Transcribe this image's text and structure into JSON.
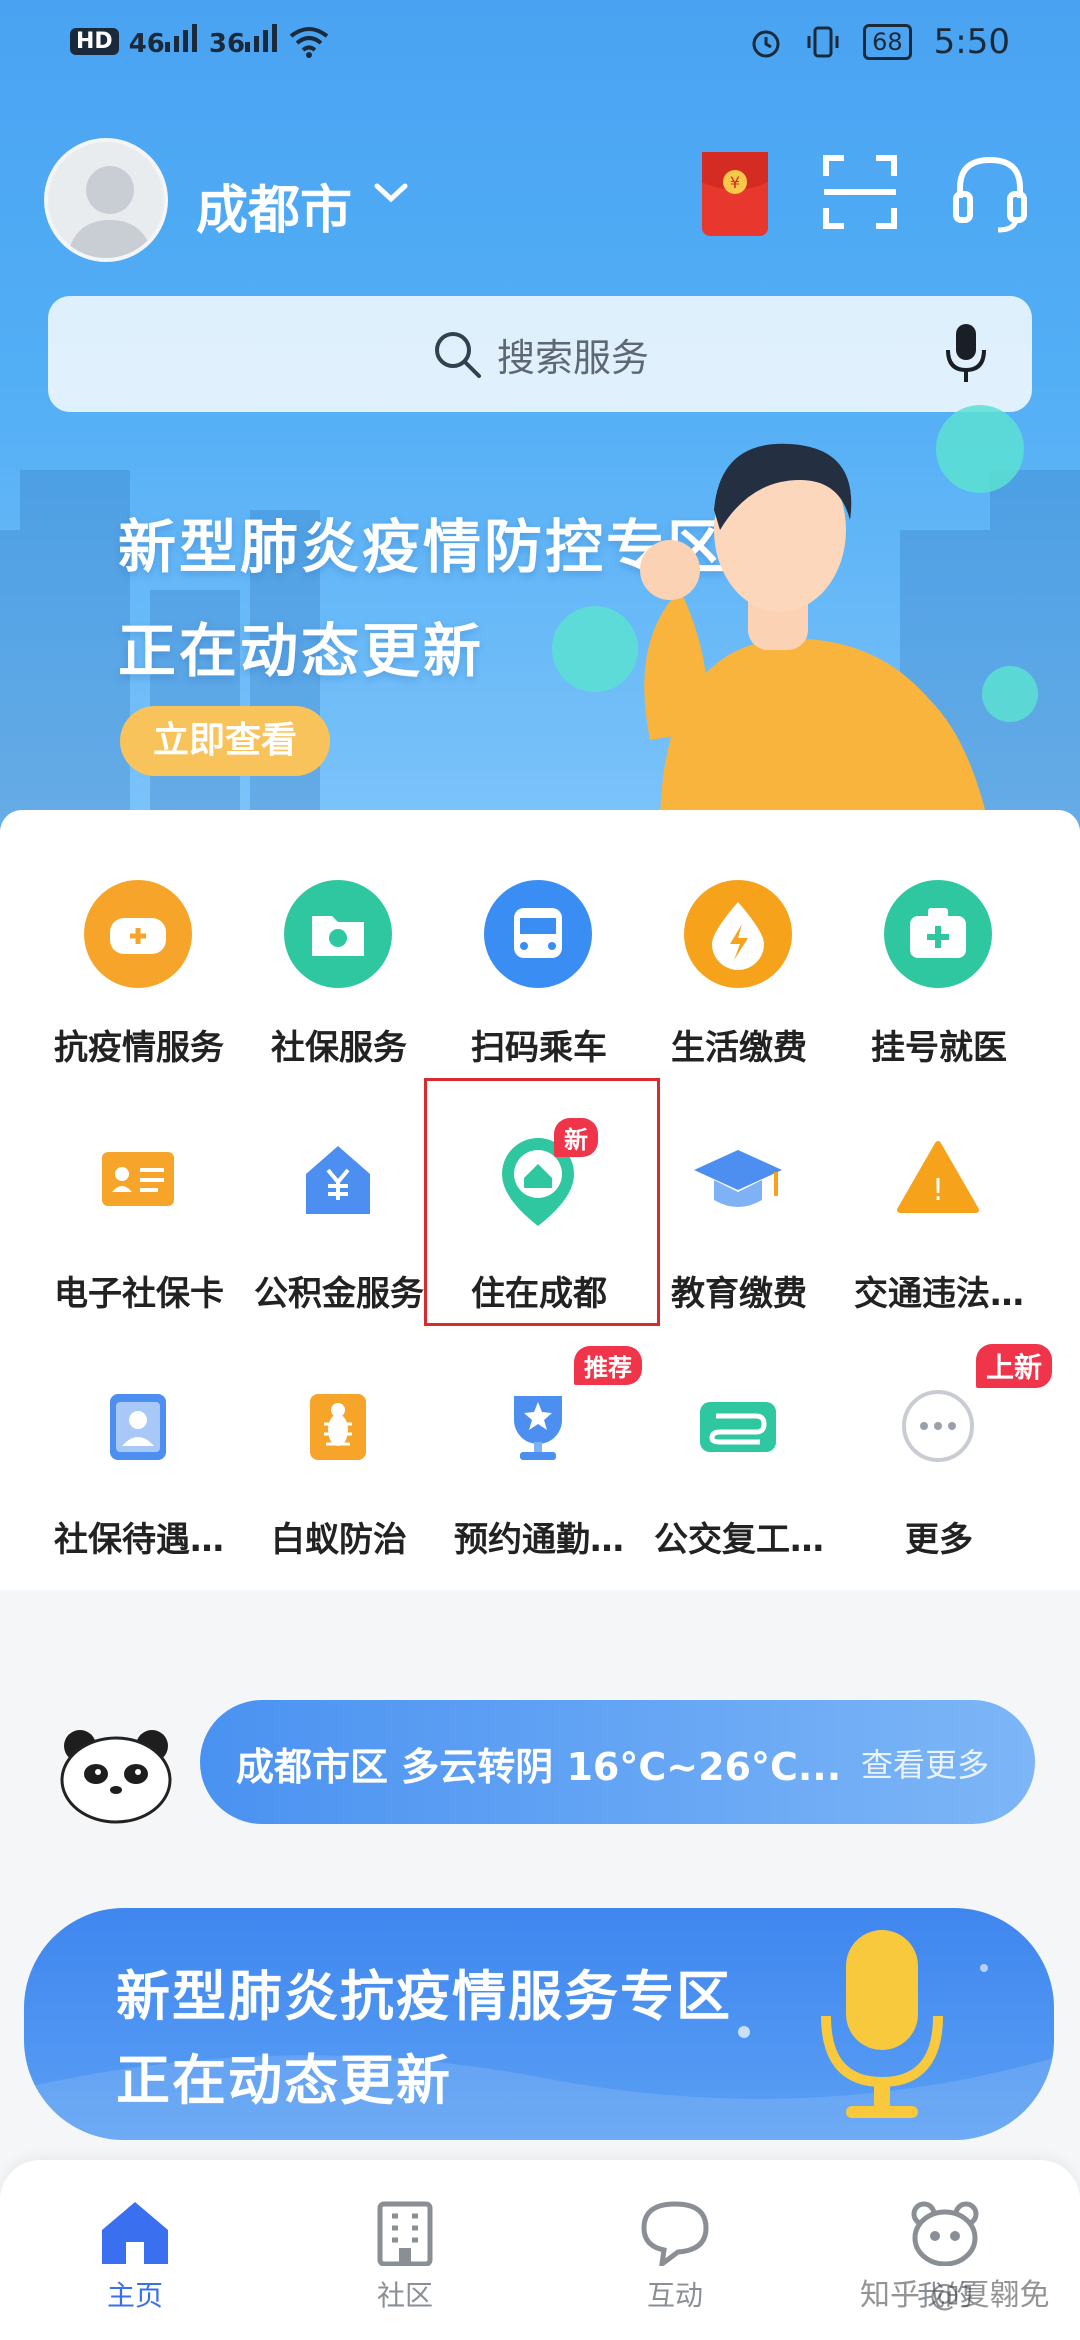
{
  "status_bar": {
    "network_left": "HD",
    "net1": "46",
    "net2": "36",
    "battery": "68",
    "time": "5:50"
  },
  "header": {
    "city": "成都市",
    "search_placeholder": "搜索服务"
  },
  "banner": {
    "line1": "新型肺炎疫情防控专区",
    "line2": "正在动态更新",
    "button": "立即查看"
  },
  "services": [
    {
      "label": "抗疫情服务",
      "icon": "mask-icon",
      "color": "#f6a52a"
    },
    {
      "label": "社保服务",
      "icon": "social-security-folder-icon",
      "color": "#2fc7a0"
    },
    {
      "label": "扫码乘车",
      "icon": "bus-icon",
      "color": "#3a8df2"
    },
    {
      "label": "生活缴费",
      "icon": "lightning-drop-icon",
      "color": "#f7a21b"
    },
    {
      "label": "挂号就医",
      "icon": "medical-kit-icon",
      "color": "#2fc7a0"
    },
    {
      "label": "电子社保卡",
      "icon": "id-card-icon",
      "color": "#f6a52a"
    },
    {
      "label": "公积金服务",
      "icon": "yuan-house-icon",
      "color": "#4c8ff0"
    },
    {
      "label": "住在成都",
      "icon": "home-pin-icon",
      "color": "#2fc7a0",
      "tag": "新"
    },
    {
      "label": "教育缴费",
      "icon": "graduation-cap-icon",
      "color": "#4c8ff0"
    },
    {
      "label": "交通违法…",
      "icon": "warning-triangle-icon",
      "color": "#f7a21b"
    },
    {
      "label": "社保待遇…",
      "icon": "person-badge-icon",
      "color": "#4c8ff0"
    },
    {
      "label": "白蚁防治",
      "icon": "termite-icon",
      "color": "#f6a52a"
    },
    {
      "label": "预约通勤…",
      "icon": "trophy-star-icon",
      "color": "#4c8ff0",
      "tag": "推荐"
    },
    {
      "label": "公交复工…",
      "icon": "route-icon",
      "color": "#2fc7a0"
    },
    {
      "label": "更多",
      "icon": "more-dots-icon",
      "color": "#c9ccd2",
      "tag": "上新"
    }
  ],
  "weather": {
    "text": "成都市区 多云转阴 16°C~26°C...",
    "more": "查看更多"
  },
  "promo": {
    "line1": "新型肺炎抗疫情服务专区",
    "line2": "正在动态更新"
  },
  "bottom_nav": [
    {
      "label": "主页",
      "active": true
    },
    {
      "label": "社区",
      "active": false
    },
    {
      "label": "互动",
      "active": false
    },
    {
      "label": "我的",
      "active": false
    }
  ],
  "watermark": "知乎 @夏翱免",
  "colors": {
    "accent": "#3a6ff0",
    "hero_blue": "#4aa3f2",
    "alert_red": "#f0344a"
  }
}
